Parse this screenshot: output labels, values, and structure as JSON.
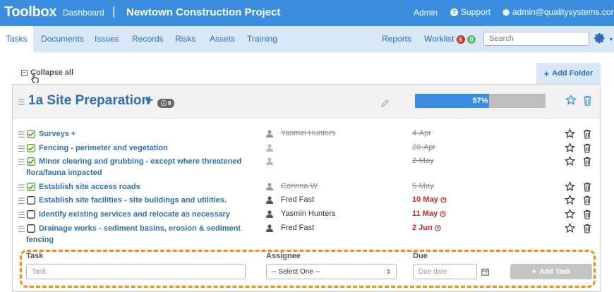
{
  "topbar": {
    "brand": "Toolbox",
    "dashboard": "Dashboard",
    "separator": "|",
    "project": "Newtown Construction Project",
    "admin": "Admin",
    "support": "Support",
    "user": "admin@qualitysystems.com"
  },
  "nav": {
    "tabs": [
      {
        "label": "Tasks",
        "active": true
      },
      {
        "label": "Documents"
      },
      {
        "label": "Issues"
      },
      {
        "label": "Records"
      },
      {
        "label": "Risks"
      },
      {
        "label": "Assets"
      },
      {
        "label": "Training"
      }
    ],
    "reports": "Reports",
    "worklist": {
      "label": "Worklist",
      "red_count": "6",
      "green_count": "0"
    },
    "search_placeholder": "Search"
  },
  "toolbar": {
    "collapse_all": "Collapse all",
    "add_folder": "Add Folder"
  },
  "folder": {
    "title": "1a Site Preparation",
    "plus": "+",
    "badge_count": "8",
    "progress_label": "57%",
    "progress_value": 0.57
  },
  "tasks": [
    {
      "name": "Surveys +",
      "assignee": "Yasmin Hunters",
      "due": "4-Apr",
      "completed": true
    },
    {
      "name": "Fencing - perimeter and vegetation",
      "assignee": "",
      "due": "20-Apr",
      "completed": true
    },
    {
      "name": "Minor clearing and grubbing - except where threatened flora/fauna impacted",
      "assignee": "",
      "due": "2-May",
      "completed": true
    },
    {
      "name": "Establish site access roads",
      "assignee": "Corinna W",
      "due": "5-May",
      "completed": true
    },
    {
      "name": "Establish site facilities - site buildings and utilities.",
      "assignee": "Fred Fast",
      "due": "10 May",
      "completed": false
    },
    {
      "name": "Identify existing services and relocate as necessary",
      "assignee": "Yasmin Hunters",
      "due": "11 May",
      "completed": false
    },
    {
      "name": "Drainage works - sediment basins, erosion & sediment fencing",
      "assignee": "Fred Fast",
      "due": "2 Jun",
      "completed": false
    }
  ],
  "add_form": {
    "task_label": "Task",
    "task_placeholder": "Task",
    "assignee_label": "Assignee",
    "assignee_selected": "-- Select One --",
    "due_label": "Due",
    "due_placeholder": "Due date",
    "add_button": "Add Task"
  },
  "colors": {
    "brand_blue": "#3b8de0",
    "nav_bg": "#d9e8f8",
    "link_blue": "#2d6fb3",
    "check_green": "#5a9e2f",
    "overdue_red": "#c62828",
    "highlight_orange": "#f08c1e"
  }
}
